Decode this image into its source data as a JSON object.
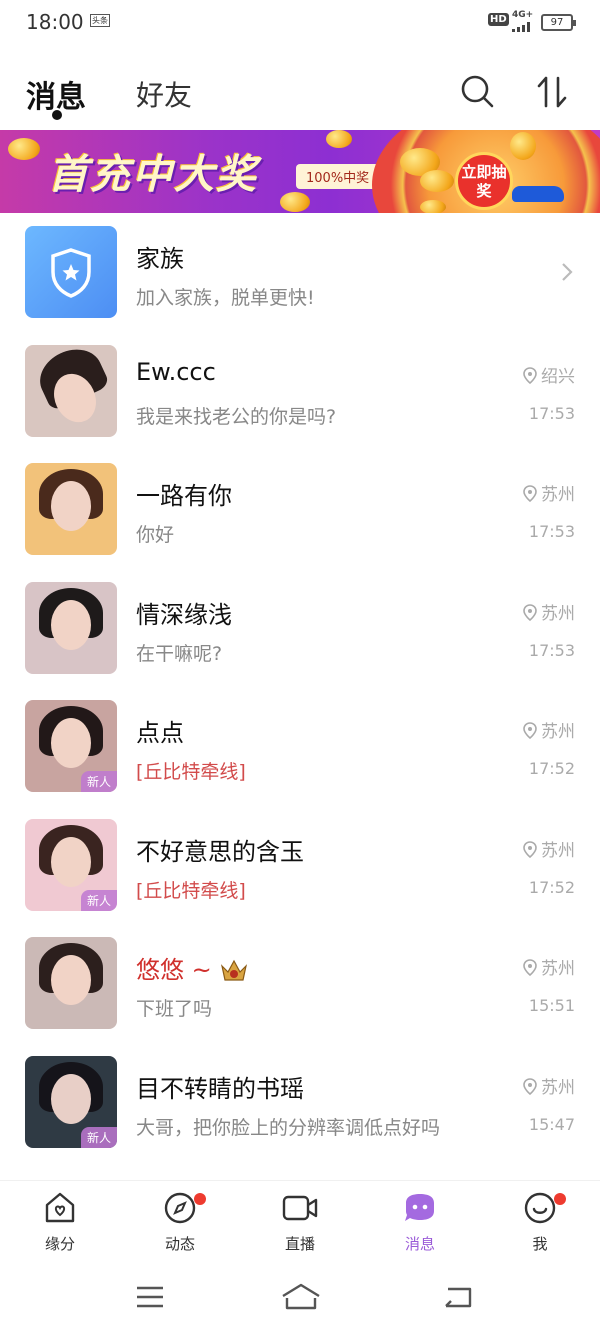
{
  "status_bar": {
    "time": "18:00",
    "news_icon_label": "头条",
    "hd": "HD",
    "network": "4G+",
    "battery": "97"
  },
  "header": {
    "tabs": [
      "消息",
      "好友"
    ]
  },
  "banner": {
    "title": "首充中大奖",
    "tag": "100%中奖",
    "button": "立即抽奖"
  },
  "family": {
    "title": "家族",
    "subtitle": "加入家族，脱单更快!"
  },
  "conversations": [
    {
      "name": "Ew.ccc",
      "preview": "我是来找老公的你是吗?",
      "location": "绍兴",
      "time": "17:53",
      "new": false
    },
    {
      "name": "一路有你",
      "preview": "你好",
      "location": "苏州",
      "time": "17:53",
      "new": false
    },
    {
      "name": "情深缘浅",
      "preview": "在干嘛呢?",
      "location": "苏州",
      "time": "17:53",
      "new": false
    },
    {
      "name": "点点",
      "preview": "[丘比特牵线]",
      "location": "苏州",
      "time": "17:52",
      "new": true
    },
    {
      "name": "不好意思的含玉",
      "preview": "[丘比特牵线]",
      "location": "苏州",
      "time": "17:52",
      "new": true
    },
    {
      "name": "悠悠 ~",
      "preview": "下班了吗",
      "location": "苏州",
      "time": "15:51",
      "new": false
    },
    {
      "name": "目不转睛的书瑶",
      "preview": "大哥，把你脸上的分辨率调低点好吗",
      "location": "苏州",
      "time": "15:47",
      "new": true
    }
  ],
  "new_badge": "新人",
  "bottom_nav": [
    "缘分",
    "动态",
    "直播",
    "消息",
    "我"
  ],
  "colors": {
    "accent": "#9a5bd8",
    "badge_red": "#ee3b2f",
    "cupid_red": "#d24b4b"
  }
}
